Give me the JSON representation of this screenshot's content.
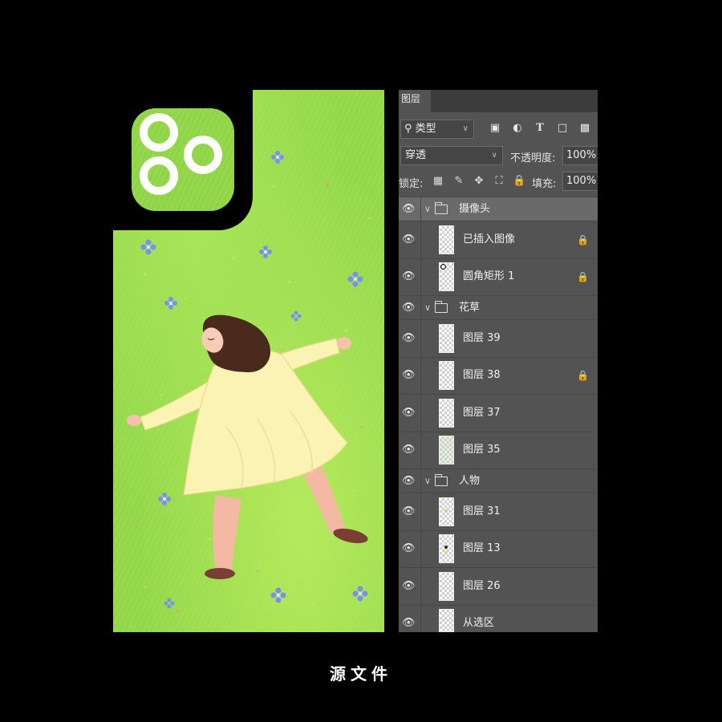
{
  "panel": {
    "tab_label": "图层",
    "filter": {
      "label": "类型"
    },
    "filter_icons": [
      "image-icon",
      "adjustment-icon",
      "type-icon",
      "shape-icon",
      "smart-object-icon"
    ],
    "blend_mode": "穿透",
    "opacity_label": "不透明度:",
    "opacity_value": "100%",
    "lock_label": "锁定:",
    "lock_icons": [
      "lock-transparent-icon",
      "lock-brush-icon",
      "lock-move-icon",
      "lock-artboard-icon",
      "lock-all-icon"
    ],
    "fill_label": "填充:",
    "fill_value": "100%",
    "layers": [
      {
        "type": "group",
        "name": "摄像头",
        "selected": true
      },
      {
        "type": "layer",
        "name": "已插入图像",
        "locked": true
      },
      {
        "type": "layer",
        "name": "圆角矩形 1",
        "locked": true
      },
      {
        "type": "group",
        "name": "花草"
      },
      {
        "type": "layer",
        "name": "图层 39"
      },
      {
        "type": "layer",
        "name": "图层 38",
        "locked": true
      },
      {
        "type": "layer",
        "name": "图层 37"
      },
      {
        "type": "layer",
        "name": "图层 35"
      },
      {
        "type": "group",
        "name": "人物"
      },
      {
        "type": "layer",
        "name": "图层 31"
      },
      {
        "type": "layer",
        "name": "图层 13"
      },
      {
        "type": "layer",
        "name": "图层 26"
      },
      {
        "type": "layer",
        "name": "从选区"
      }
    ]
  },
  "caption": "源文件",
  "colors": {
    "background": "#000000",
    "grass": "#93d848",
    "dress": "#fbf3b4",
    "hair": "#4a2a1c",
    "flower": "#7c8ff0",
    "panel": "#535353"
  }
}
